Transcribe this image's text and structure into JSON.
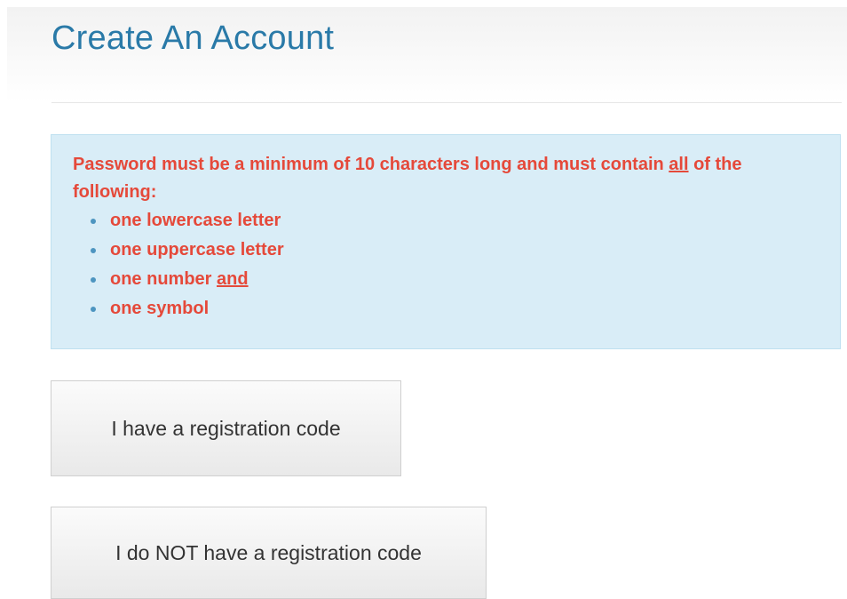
{
  "page": {
    "title": "Create An Account"
  },
  "password_notice": {
    "intro_before": "Password must be a minimum of 10 characters long and must contain ",
    "intro_emphasis": "all",
    "intro_after": " of the following:",
    "requirements": [
      {
        "text": "one lowercase letter",
        "emphasis": ""
      },
      {
        "text": "one uppercase letter",
        "emphasis": ""
      },
      {
        "text": "one number ",
        "emphasis": "and"
      },
      {
        "text": "one symbol",
        "emphasis": ""
      }
    ]
  },
  "actions": {
    "has_code_label": "I have a registration code",
    "no_code_label": "I do NOT have a registration code"
  },
  "colors": {
    "title": "#2a7aa8",
    "notice_background": "#d9edf7",
    "notice_text": "#e5493a",
    "bullet": "#4d95c0"
  }
}
